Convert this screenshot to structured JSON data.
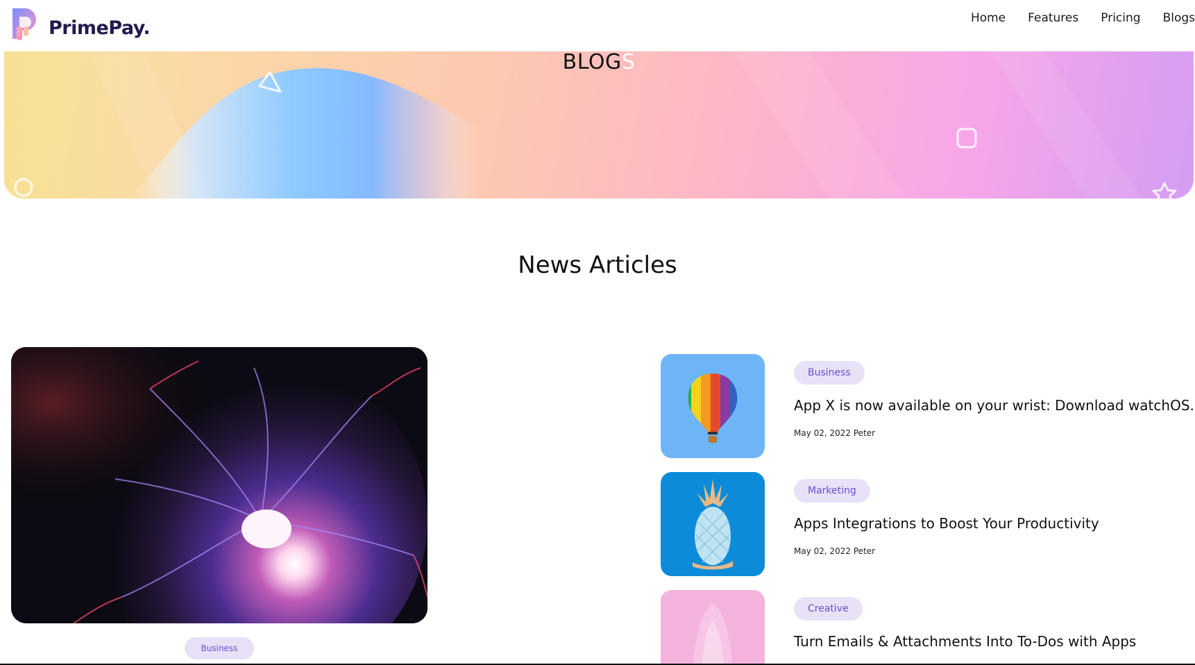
{
  "brand": {
    "name": "PrimePay."
  },
  "nav": {
    "items": [
      "Home",
      "Features",
      "Pricing",
      "Blogs"
    ]
  },
  "hero": {
    "title_main": "BLOG",
    "title_last": "S"
  },
  "section": {
    "title": "News Articles"
  },
  "featured": {
    "badge": "Business"
  },
  "articles": [
    {
      "category": "Business",
      "title": "App X is now available on your wrist: Download watchOS...",
      "meta": "May 02, 2022 Peter",
      "thumb_icon": "hot-air-balloon-image"
    },
    {
      "category": "Marketing",
      "title": "Apps Integrations to Boost Your Productivity",
      "meta": "May 02, 2022 Peter",
      "thumb_icon": "pineapple-image"
    },
    {
      "category": "Creative",
      "title": "Turn Emails & Attachments Into To-Dos with Apps",
      "meta": "",
      "thumb_icon": "pink-chair-image"
    }
  ],
  "colors": {
    "brand_dark": "#1f1a4d",
    "badge_bg": "#e8e1f8",
    "badge_text": "#6b4fcf",
    "thumb_blue_1": "#6db5f7",
    "thumb_blue_2": "#0c8bd8",
    "thumb_pink": "#f4b3dd"
  }
}
